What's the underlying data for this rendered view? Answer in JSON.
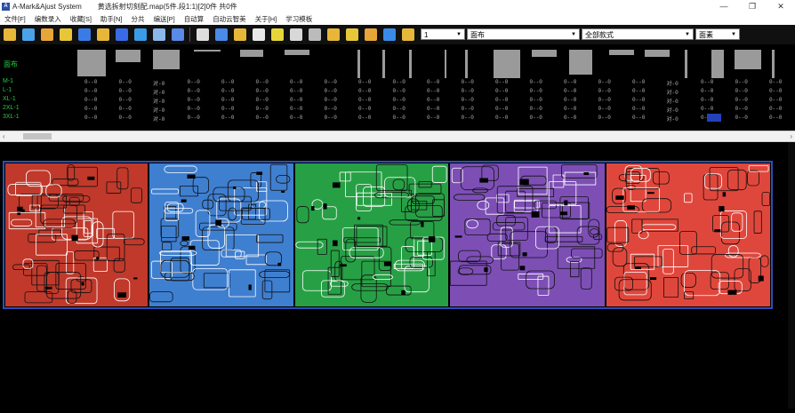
{
  "window": {
    "app_name": "A-Mark&Ajust System",
    "document_title": "黄选拆射切刻配.map(5件.段1:1)[2]0件 共0件",
    "minimize_glyph": "—",
    "restore_glyph": "❐",
    "close_glyph": "✕"
  },
  "menu": [
    "文件[F]",
    "编数录入",
    "收藏[S]",
    "助手[N]",
    "分共",
    "编送[P]",
    "自动算",
    "自动云智美",
    "关于[H]",
    "学习模板"
  ],
  "toolbar": {
    "help_glyph": "?",
    "select1_value": "1",
    "select2_value": "面布",
    "select3_value": "全部款式",
    "select4_value": "面素",
    "icon_colors": [
      "#e7b73a",
      "#4aa3e8",
      "#e7a53a",
      "#e7c63a",
      "#3a7be7",
      "#e7b73a",
      "#3a6be7",
      "#3a9be7",
      "#8ab8e8",
      "#5a8ae8",
      "#dddddd",
      "#4a8ae8",
      "#e7b73a",
      "#e8e8e8",
      "#e7d63a",
      "#d8d8d8",
      "#bbbbbb",
      "#e7b73a",
      "#e7c63a",
      "#e7a53a",
      "#3a8be7"
    ]
  },
  "sizes_header": "面布",
  "size_rows": [
    {
      "label": "M-1",
      "values": [
        "0--0",
        "0--0",
        "对-0",
        "0--0",
        "0--0",
        "0--0",
        "0--0",
        "0--0",
        "0--0",
        "0--0",
        "0--0",
        "0--0",
        "0--0",
        "0--0",
        "0--0",
        "0--0",
        "0--0",
        "对-0",
        "0--0",
        "0--0",
        "0--0",
        "0--0"
      ]
    },
    {
      "label": "L-1",
      "values": [
        "0--0",
        "0--0",
        "对-0",
        "0--0",
        "0--0",
        "0--0",
        "0--0",
        "0--0",
        "0--0",
        "0--0",
        "0--0",
        "0--0",
        "0--0",
        "0--0",
        "0--0",
        "0--0",
        "0--0",
        "对-0",
        "0--0",
        "0--0",
        "0--0",
        "0--0"
      ]
    },
    {
      "label": "XL-1",
      "values": [
        "0--0",
        "0--0",
        "对-0",
        "0--0",
        "0--0",
        "0--0",
        "0--0",
        "0--0",
        "0--0",
        "0--0",
        "0--0",
        "0--0",
        "0--0",
        "0--0",
        "0--0",
        "0--0",
        "0--0",
        "对-0",
        "0--0",
        "0--0",
        "0--0",
        "0--0"
      ]
    },
    {
      "label": "2XL-1",
      "values": [
        "0--0",
        "0--0",
        "对-0",
        "0--0",
        "0--0",
        "0--0",
        "0--0",
        "0--0",
        "0--0",
        "0--0",
        "0--0",
        "0--0",
        "0--0",
        "0--0",
        "0--0",
        "0--0",
        "0--0",
        "对-0",
        "0--0",
        "0--0",
        "0--0",
        "0--0"
      ]
    },
    {
      "label": "3XL-1",
      "values": [
        "0--0",
        "0--0",
        "对-0",
        "0--0",
        "0--0",
        "0--0",
        "0--0",
        "0--0",
        "0--0",
        "0--0",
        "0--0",
        "0--0",
        "0--0",
        "0--0",
        "0--0",
        "0--0",
        "0--0",
        "对-0",
        "0--0",
        "0--0",
        "0--0",
        "0--0"
      ]
    }
  ],
  "scrollbar": {
    "left_arrow": "‹",
    "right_arrow": "›"
  },
  "marker_blocks": [
    {
      "color": "#c0392b"
    },
    {
      "color": "#3f7fd0"
    },
    {
      "color": "#27a045"
    },
    {
      "color": "#7d4fb5"
    },
    {
      "color": "#e0473c"
    }
  ]
}
